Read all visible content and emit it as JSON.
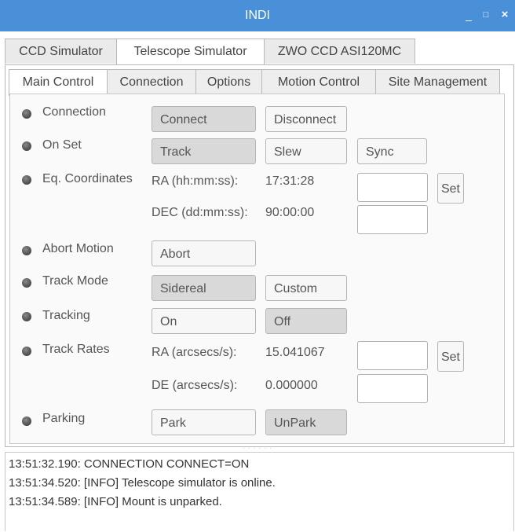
{
  "window": {
    "title": "INDI",
    "controls": {
      "minimize": "_",
      "maximize": "□",
      "close": "×"
    }
  },
  "device_tabs": [
    "CCD Simulator",
    "Telescope Simulator",
    "ZWO CCD ASI120MC"
  ],
  "active_device_tab": "Telescope Simulator",
  "group_tabs": [
    "Main Control",
    "Connection",
    "Options",
    "Motion Control",
    "Site Management"
  ],
  "active_group_tab": "Main Control",
  "properties": {
    "connection": {
      "label": "Connection",
      "connect": "Connect",
      "disconnect": "Disconnect"
    },
    "on_set": {
      "label": "On Set",
      "track": "Track",
      "slew": "Slew",
      "sync": "Sync"
    },
    "eq_coords": {
      "label": "Eq. Coordinates",
      "ra_label": "RA (hh:mm:ss):",
      "ra_value": "17:31:28",
      "dec_label": "DEC (dd:mm:ss):",
      "dec_value": "90:00:00",
      "set": "Set"
    },
    "abort": {
      "label": "Abort Motion",
      "abort": "Abort"
    },
    "track_mode": {
      "label": "Track Mode",
      "sidereal": "Sidereal",
      "custom": "Custom"
    },
    "tracking": {
      "label": "Tracking",
      "on": "On",
      "off": "Off"
    },
    "track_rates": {
      "label": "Track Rates",
      "ra_label": "RA (arcsecs/s):",
      "ra_value": "15.041067",
      "de_label": "DE (arcsecs/s):",
      "de_value": "0.000000",
      "set": "Set"
    },
    "parking": {
      "label": "Parking",
      "park": "Park",
      "unpark": "UnPark"
    }
  },
  "log": [
    "13:51:32.190: CONNECTION CONNECT=ON",
    "13:51:34.520: [INFO] Telescope simulator is online.",
    "13:51:34.589: [INFO] Mount is unparked."
  ],
  "colors": {
    "titlebar": "#4a90d9",
    "led": "#555555"
  }
}
